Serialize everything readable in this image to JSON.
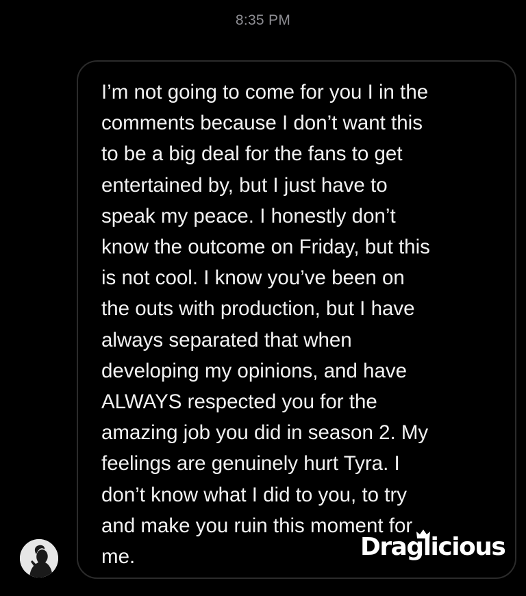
{
  "thread": {
    "timestamp": "8:35 PM"
  },
  "message": {
    "text": "I’m not going to come for you I in the\ncomments because I don’t want this\nto be a big deal for the fans to get\nentertained by, but I just have to\nspeak my peace. I honestly don’t\nknow the outcome on Friday, but this\nis not cool. I know you’ve been on\nthe outs with production, but I have\nalways separated that when\ndeveloping my opinions, and have\nALWAYS respected you for the\namazing job you did in season 2. My\nfeelings are genuinely hurt Tyra. I\ndon’t know what I did to you, to try\nand make you ruin this moment for\nme."
  },
  "watermark": {
    "text": "Draglicious"
  },
  "colors": {
    "background": "#000000",
    "bubble_border": "#2b2b2b",
    "message_text": "#f2f2f2",
    "timestamp_text": "#8e8e93",
    "avatar_bg": "#e4e4e4"
  },
  "icons": {
    "avatar": "profile-photo-silhouette",
    "watermark_crown": "crown-icon"
  }
}
